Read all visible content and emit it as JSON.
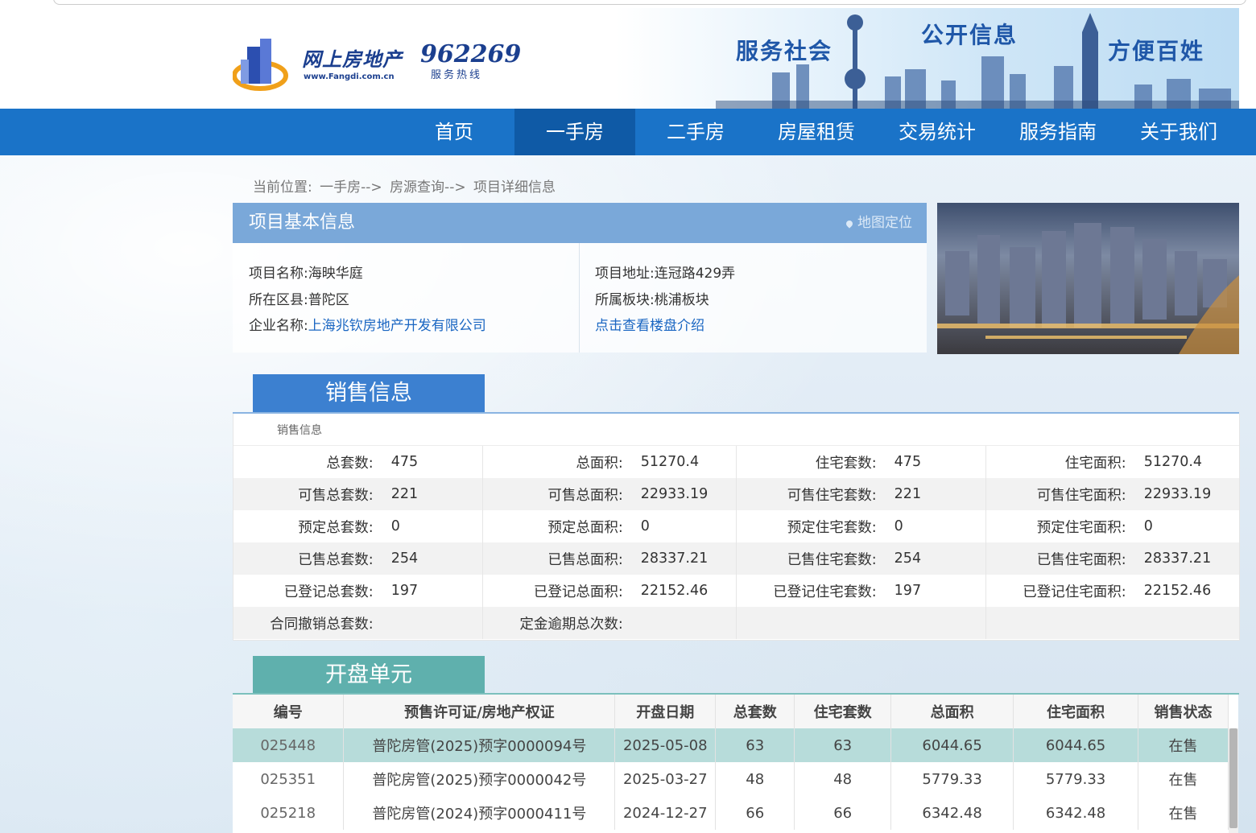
{
  "header": {
    "logo_text": "网上房地产",
    "logo_url": "www.Fangdi.com.cn",
    "hotline": "962269",
    "hotline_sub": "服务热线",
    "slogans": [
      "服务社会",
      "公开信息",
      "方便百姓"
    ]
  },
  "nav": {
    "items": [
      "首页",
      "一手房",
      "二手房",
      "房屋租赁",
      "交易统计",
      "服务指南",
      "关于我们"
    ],
    "active": "一手房"
  },
  "breadcrumb": {
    "prefix": "当前位置:",
    "items": [
      "一手房-->",
      "房源查询-->",
      "项目详细信息"
    ]
  },
  "basic": {
    "title": "项目基本信息",
    "map_link": "地图定位",
    "left": [
      {
        "label": "项目名称:",
        "value": "海映华庭"
      },
      {
        "label": "所在区县:",
        "value": "普陀区"
      },
      {
        "label": "企业名称:",
        "value": "上海兆钦房地产开发有限公司"
      }
    ],
    "right": [
      {
        "label": "项目地址:",
        "value": "连冠路429弄"
      },
      {
        "label": "所属板块:",
        "value": "桃浦板块"
      }
    ],
    "intro_link": "点击查看楼盘介绍"
  },
  "sales": {
    "tab": "销售信息",
    "subtitle": "销售信息",
    "rows": [
      [
        [
          "总套数:",
          "475"
        ],
        [
          "总面积:",
          "51270.4"
        ],
        [
          "住宅套数:",
          "475"
        ],
        [
          "住宅面积:",
          "51270.4"
        ]
      ],
      [
        [
          "可售总套数:",
          "221"
        ],
        [
          "可售总面积:",
          "22933.19"
        ],
        [
          "可售住宅套数:",
          "221"
        ],
        [
          "可售住宅面积:",
          "22933.19"
        ]
      ],
      [
        [
          "预定总套数:",
          "0"
        ],
        [
          "预定总面积:",
          "0"
        ],
        [
          "预定住宅套数:",
          "0"
        ],
        [
          "预定住宅面积:",
          "0"
        ]
      ],
      [
        [
          "已售总套数:",
          "254"
        ],
        [
          "已售总面积:",
          "28337.21"
        ],
        [
          "已售住宅套数:",
          "254"
        ],
        [
          "已售住宅面积:",
          "28337.21"
        ]
      ],
      [
        [
          "已登记总套数:",
          "197"
        ],
        [
          "已登记总面积:",
          "22152.46"
        ],
        [
          "已登记住宅套数:",
          "197"
        ],
        [
          "已登记住宅面积:",
          "22152.46"
        ]
      ],
      [
        [
          "合同撤销总套数:",
          ""
        ],
        [
          "定金逾期总次数:",
          ""
        ],
        [
          "",
          ""
        ],
        [
          "",
          ""
        ]
      ]
    ]
  },
  "units": {
    "tab": "开盘单元",
    "headers": [
      "编号",
      "预售许可证/房地产权证",
      "开盘日期",
      "总套数",
      "住宅套数",
      "总面积",
      "住宅面积",
      "销售状态"
    ],
    "rows": [
      [
        "025448",
        "普陀房管(2025)预字0000094号",
        "2025-05-08",
        "63",
        "63",
        "6044.65",
        "6044.65",
        "在售"
      ],
      [
        "025351",
        "普陀房管(2025)预字0000042号",
        "2025-03-27",
        "48",
        "48",
        "5779.33",
        "5779.33",
        "在售"
      ],
      [
        "025218",
        "普陀房管(2024)预字0000411号",
        "2024-12-27",
        "66",
        "66",
        "6342.48",
        "6342.48",
        "在售"
      ]
    ]
  },
  "colors": {
    "nav_bg": "#1a73c8",
    "nav_active": "#0f5aa6",
    "basic_head": "#7aa8d9",
    "sales_tab": "#3c80d0",
    "units_tab": "#5fb0ad",
    "link": "#1a66c2",
    "status_green": "#1e8f3c"
  }
}
